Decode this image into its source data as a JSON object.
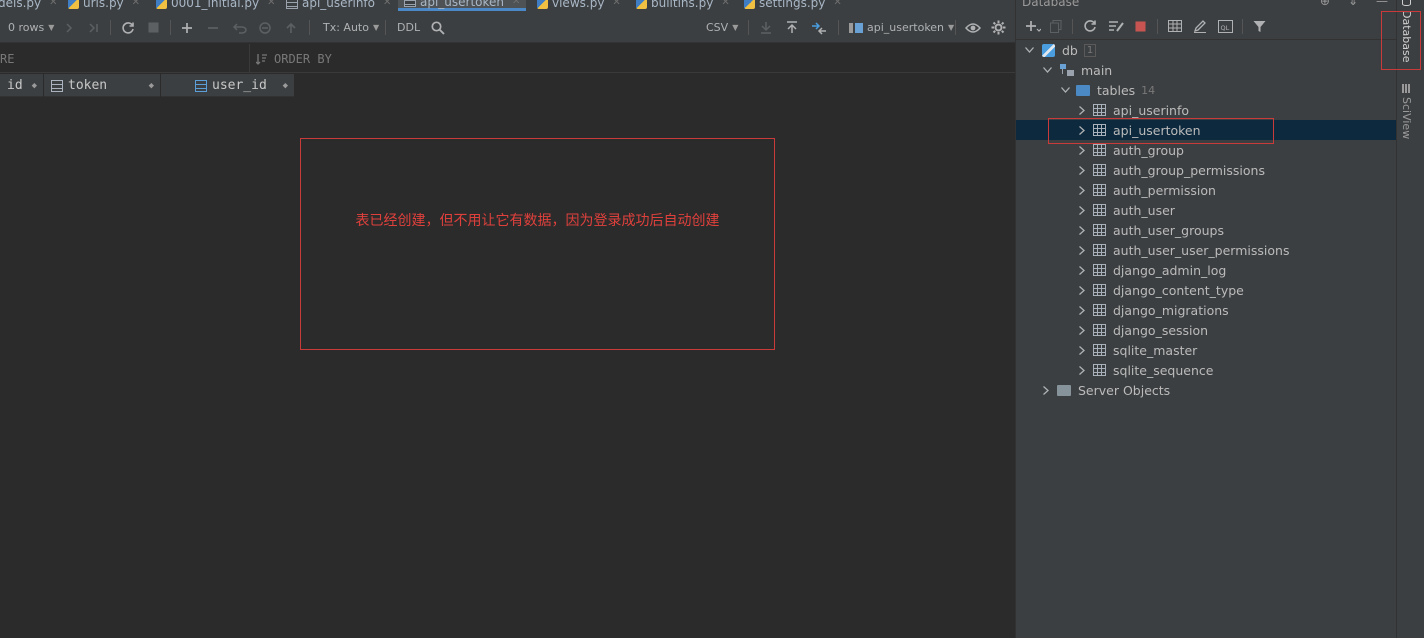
{
  "editor_tabs": [
    {
      "label": "dels.py",
      "icon": "python-file-icon"
    },
    {
      "label": "urls.py",
      "icon": "python-file-icon"
    },
    {
      "label": "0001_initial.py",
      "icon": "python-file-icon"
    },
    {
      "label": "api_userinfo",
      "icon": "table-icon"
    },
    {
      "label": "api_usertoken",
      "icon": "table-icon",
      "active": true
    },
    {
      "label": "views.py",
      "icon": "python-file-icon"
    },
    {
      "label": "builtins.py",
      "icon": "python-file-icon"
    },
    {
      "label": "settings.py",
      "icon": "python-file-icon"
    }
  ],
  "toolbar": {
    "rows": "0 rows",
    "tx": "Tx: Auto",
    "ddl": "DDL",
    "csv": "CSV",
    "datasource": "api_usertoken"
  },
  "filter": {
    "where": "RE",
    "order_by": "ORDER BY"
  },
  "columns": [
    {
      "name": "id",
      "key": false
    },
    {
      "name": "token",
      "key": false
    },
    {
      "name": "user_id",
      "key": true
    }
  ],
  "annotation": {
    "text": "表已经创建，但不用让它有数据，因为登录成功后自动创建",
    "color": "#e0403c"
  },
  "database_panel": {
    "title": "Database",
    "tree": [
      {
        "label": "db",
        "badge": "1",
        "depth": 0,
        "expanded": true,
        "kind": "db"
      },
      {
        "label": "main",
        "depth": 1,
        "expanded": true,
        "kind": "schema"
      },
      {
        "label": "tables",
        "count": "14",
        "depth": 2,
        "expanded": true,
        "kind": "folder"
      },
      {
        "label": "api_userinfo",
        "depth": 3,
        "kind": "table"
      },
      {
        "label": "api_usertoken",
        "depth": 3,
        "kind": "table",
        "selected": true
      },
      {
        "label": "auth_group",
        "depth": 3,
        "kind": "table"
      },
      {
        "label": "auth_group_permissions",
        "depth": 3,
        "kind": "table"
      },
      {
        "label": "auth_permission",
        "depth": 3,
        "kind": "table"
      },
      {
        "label": "auth_user",
        "depth": 3,
        "kind": "table"
      },
      {
        "label": "auth_user_groups",
        "depth": 3,
        "kind": "table"
      },
      {
        "label": "auth_user_user_permissions",
        "depth": 3,
        "kind": "table"
      },
      {
        "label": "django_admin_log",
        "depth": 3,
        "kind": "table"
      },
      {
        "label": "django_content_type",
        "depth": 3,
        "kind": "table"
      },
      {
        "label": "django_migrations",
        "depth": 3,
        "kind": "table"
      },
      {
        "label": "django_session",
        "depth": 3,
        "kind": "table"
      },
      {
        "label": "sqlite_master",
        "depth": 3,
        "kind": "table"
      },
      {
        "label": "sqlite_sequence",
        "depth": 3,
        "kind": "table"
      },
      {
        "label": "Server Objects",
        "depth": 1,
        "kind": "folder"
      }
    ]
  },
  "side_strip": {
    "database_tab": "Database",
    "sciview_tab": "SciView"
  },
  "colors": {
    "background": "#2b2b2b",
    "panel": "#3c3f41",
    "selection": "#0d293e",
    "highlight_border": "#c93a3a",
    "accent": "#4a88c7"
  }
}
